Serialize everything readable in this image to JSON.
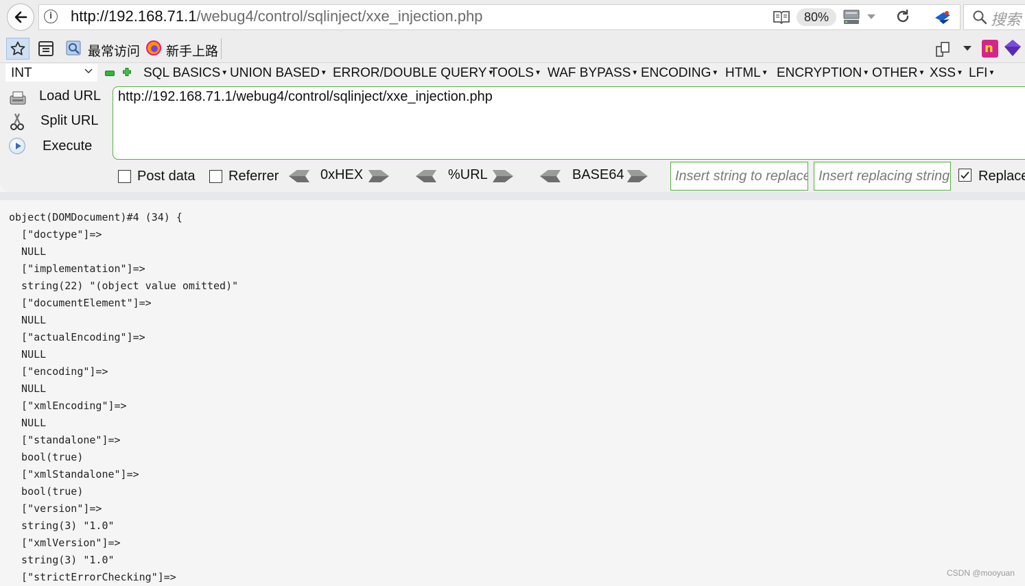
{
  "browser": {
    "url_host": "http://192.168.71.1",
    "url_path": "/webug4/control/sqlinject/xxe_injection.php",
    "zoom": "80%",
    "search_placeholder": "搜索"
  },
  "bookmarks": {
    "items": [
      {
        "label": "最常访问",
        "icon": "bookmark-icon"
      },
      {
        "label": "新手上路",
        "icon": "firefox-icon"
      }
    ]
  },
  "hackbar": {
    "type_select": "INT",
    "menus": [
      "SQL BASICS",
      "UNION BASED",
      "ERROR/DOUBLE QUERY",
      "TOOLS",
      "WAF BYPASS",
      "ENCODING",
      "HTML",
      "ENCRYPTION",
      "OTHER",
      "XSS",
      "LFI"
    ],
    "actions": {
      "load": "Load URL",
      "split": "Split URL",
      "execute": "Execute"
    },
    "url_value": "http://192.168.71.1/webug4/control/sqlinject/xxe_injection.php",
    "post_data_label": "Post data",
    "referrer_label": "Referrer",
    "encoders": [
      "0xHEX",
      "%URL",
      "BASE64"
    ],
    "replace_placeholder": "Insert string to replace",
    "replacing_placeholder": "Insert replacing string",
    "replace_all_label": "Replace All",
    "post_data_checked": false,
    "referrer_checked": false,
    "replace_checked": true,
    "accent_color": "#52b03d"
  },
  "output": {
    "lines": [
      "object(DOMDocument)#4 (34) {",
      "  [\"doctype\"]=>",
      "  NULL",
      "  [\"implementation\"]=>",
      "  string(22) \"(object value omitted)\"",
      "  [\"documentElement\"]=>",
      "  NULL",
      "  [\"actualEncoding\"]=>",
      "  NULL",
      "  [\"encoding\"]=>",
      "  NULL",
      "  [\"xmlEncoding\"]=>",
      "  NULL",
      "  [\"standalone\"]=>",
      "  bool(true)",
      "  [\"xmlStandalone\"]=>",
      "  bool(true)",
      "  [\"version\"]=>",
      "  string(3) \"1.0\"",
      "  [\"xmlVersion\"]=>",
      "  string(3) \"1.0\"",
      "  [\"strictErrorChecking\"]=>"
    ]
  },
  "watermark": "CSDN @mooyuan"
}
